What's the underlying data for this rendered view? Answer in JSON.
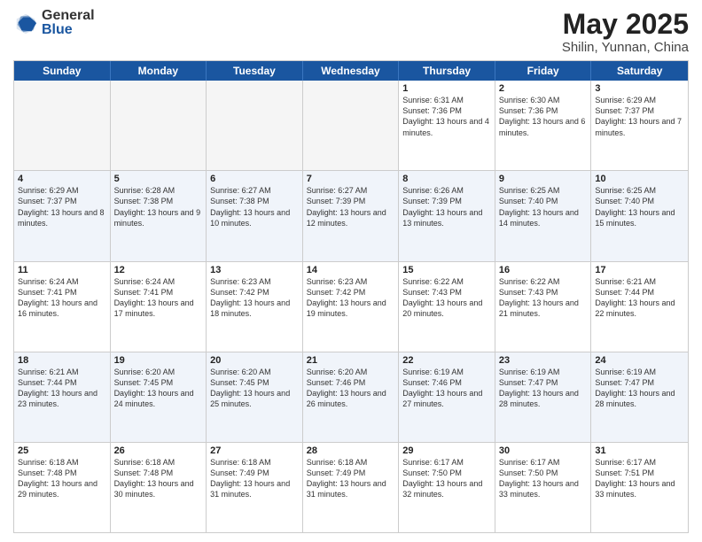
{
  "header": {
    "logo_general": "General",
    "logo_blue": "Blue",
    "title": "May 2025",
    "location": "Shilin, Yunnan, China"
  },
  "weekdays": [
    "Sunday",
    "Monday",
    "Tuesday",
    "Wednesday",
    "Thursday",
    "Friday",
    "Saturday"
  ],
  "rows": [
    [
      {
        "day": "",
        "info": "",
        "empty": true
      },
      {
        "day": "",
        "info": "",
        "empty": true
      },
      {
        "day": "",
        "info": "",
        "empty": true
      },
      {
        "day": "",
        "info": "",
        "empty": true
      },
      {
        "day": "1",
        "info": "Sunrise: 6:31 AM\nSunset: 7:36 PM\nDaylight: 13 hours\nand 4 minutes.",
        "empty": false
      },
      {
        "day": "2",
        "info": "Sunrise: 6:30 AM\nSunset: 7:36 PM\nDaylight: 13 hours\nand 6 minutes.",
        "empty": false
      },
      {
        "day": "3",
        "info": "Sunrise: 6:29 AM\nSunset: 7:37 PM\nDaylight: 13 hours\nand 7 minutes.",
        "empty": false
      }
    ],
    [
      {
        "day": "4",
        "info": "Sunrise: 6:29 AM\nSunset: 7:37 PM\nDaylight: 13 hours\nand 8 minutes.",
        "empty": false
      },
      {
        "day": "5",
        "info": "Sunrise: 6:28 AM\nSunset: 7:38 PM\nDaylight: 13 hours\nand 9 minutes.",
        "empty": false
      },
      {
        "day": "6",
        "info": "Sunrise: 6:27 AM\nSunset: 7:38 PM\nDaylight: 13 hours\nand 10 minutes.",
        "empty": false
      },
      {
        "day": "7",
        "info": "Sunrise: 6:27 AM\nSunset: 7:39 PM\nDaylight: 13 hours\nand 12 minutes.",
        "empty": false
      },
      {
        "day": "8",
        "info": "Sunrise: 6:26 AM\nSunset: 7:39 PM\nDaylight: 13 hours\nand 13 minutes.",
        "empty": false
      },
      {
        "day": "9",
        "info": "Sunrise: 6:25 AM\nSunset: 7:40 PM\nDaylight: 13 hours\nand 14 minutes.",
        "empty": false
      },
      {
        "day": "10",
        "info": "Sunrise: 6:25 AM\nSunset: 7:40 PM\nDaylight: 13 hours\nand 15 minutes.",
        "empty": false
      }
    ],
    [
      {
        "day": "11",
        "info": "Sunrise: 6:24 AM\nSunset: 7:41 PM\nDaylight: 13 hours\nand 16 minutes.",
        "empty": false
      },
      {
        "day": "12",
        "info": "Sunrise: 6:24 AM\nSunset: 7:41 PM\nDaylight: 13 hours\nand 17 minutes.",
        "empty": false
      },
      {
        "day": "13",
        "info": "Sunrise: 6:23 AM\nSunset: 7:42 PM\nDaylight: 13 hours\nand 18 minutes.",
        "empty": false
      },
      {
        "day": "14",
        "info": "Sunrise: 6:23 AM\nSunset: 7:42 PM\nDaylight: 13 hours\nand 19 minutes.",
        "empty": false
      },
      {
        "day": "15",
        "info": "Sunrise: 6:22 AM\nSunset: 7:43 PM\nDaylight: 13 hours\nand 20 minutes.",
        "empty": false
      },
      {
        "day": "16",
        "info": "Sunrise: 6:22 AM\nSunset: 7:43 PM\nDaylight: 13 hours\nand 21 minutes.",
        "empty": false
      },
      {
        "day": "17",
        "info": "Sunrise: 6:21 AM\nSunset: 7:44 PM\nDaylight: 13 hours\nand 22 minutes.",
        "empty": false
      }
    ],
    [
      {
        "day": "18",
        "info": "Sunrise: 6:21 AM\nSunset: 7:44 PM\nDaylight: 13 hours\nand 23 minutes.",
        "empty": false
      },
      {
        "day": "19",
        "info": "Sunrise: 6:20 AM\nSunset: 7:45 PM\nDaylight: 13 hours\nand 24 minutes.",
        "empty": false
      },
      {
        "day": "20",
        "info": "Sunrise: 6:20 AM\nSunset: 7:45 PM\nDaylight: 13 hours\nand 25 minutes.",
        "empty": false
      },
      {
        "day": "21",
        "info": "Sunrise: 6:20 AM\nSunset: 7:46 PM\nDaylight: 13 hours\nand 26 minutes.",
        "empty": false
      },
      {
        "day": "22",
        "info": "Sunrise: 6:19 AM\nSunset: 7:46 PM\nDaylight: 13 hours\nand 27 minutes.",
        "empty": false
      },
      {
        "day": "23",
        "info": "Sunrise: 6:19 AM\nSunset: 7:47 PM\nDaylight: 13 hours\nand 28 minutes.",
        "empty": false
      },
      {
        "day": "24",
        "info": "Sunrise: 6:19 AM\nSunset: 7:47 PM\nDaylight: 13 hours\nand 28 minutes.",
        "empty": false
      }
    ],
    [
      {
        "day": "25",
        "info": "Sunrise: 6:18 AM\nSunset: 7:48 PM\nDaylight: 13 hours\nand 29 minutes.",
        "empty": false
      },
      {
        "day": "26",
        "info": "Sunrise: 6:18 AM\nSunset: 7:48 PM\nDaylight: 13 hours\nand 30 minutes.",
        "empty": false
      },
      {
        "day": "27",
        "info": "Sunrise: 6:18 AM\nSunset: 7:49 PM\nDaylight: 13 hours\nand 31 minutes.",
        "empty": false
      },
      {
        "day": "28",
        "info": "Sunrise: 6:18 AM\nSunset: 7:49 PM\nDaylight: 13 hours\nand 31 minutes.",
        "empty": false
      },
      {
        "day": "29",
        "info": "Sunrise: 6:17 AM\nSunset: 7:50 PM\nDaylight: 13 hours\nand 32 minutes.",
        "empty": false
      },
      {
        "day": "30",
        "info": "Sunrise: 6:17 AM\nSunset: 7:50 PM\nDaylight: 13 hours\nand 33 minutes.",
        "empty": false
      },
      {
        "day": "31",
        "info": "Sunrise: 6:17 AM\nSunset: 7:51 PM\nDaylight: 13 hours\nand 33 minutes.",
        "empty": false
      }
    ]
  ]
}
